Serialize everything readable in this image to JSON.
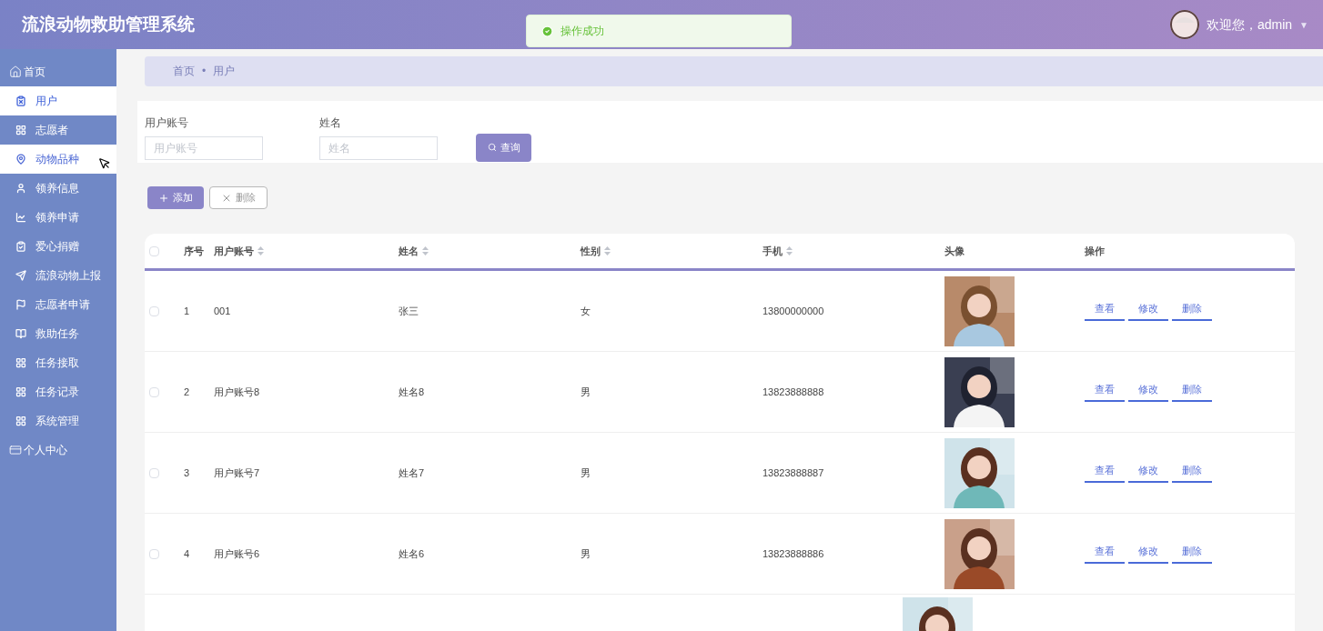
{
  "header": {
    "title": "流浪动物救助管理系统",
    "welcome": "欢迎您，admin",
    "caret": "▼"
  },
  "toast": {
    "message": "操作成功"
  },
  "sidebar": {
    "items": [
      {
        "label": "首页",
        "selected": false,
        "hovered": false,
        "kind": "top"
      },
      {
        "label": "用户",
        "selected": true,
        "hovered": false,
        "kind": "menu"
      },
      {
        "label": "志愿者",
        "selected": false,
        "hovered": false,
        "kind": "menu"
      },
      {
        "label": "动物品种",
        "selected": false,
        "hovered": true,
        "kind": "menu"
      },
      {
        "label": "领养信息",
        "selected": false,
        "hovered": false,
        "kind": "menu"
      },
      {
        "label": "领养申请",
        "selected": false,
        "hovered": false,
        "kind": "menu"
      },
      {
        "label": "爱心捐赠",
        "selected": false,
        "hovered": false,
        "kind": "menu"
      },
      {
        "label": "流浪动物上报",
        "selected": false,
        "hovered": false,
        "kind": "menu"
      },
      {
        "label": "志愿者申请",
        "selected": false,
        "hovered": false,
        "kind": "menu"
      },
      {
        "label": "救助任务",
        "selected": false,
        "hovered": false,
        "kind": "menu"
      },
      {
        "label": "任务接取",
        "selected": false,
        "hovered": false,
        "kind": "menu"
      },
      {
        "label": "任务记录",
        "selected": false,
        "hovered": false,
        "kind": "menu"
      },
      {
        "label": "系统管理",
        "selected": false,
        "hovered": false,
        "kind": "menu"
      },
      {
        "label": "个人中心",
        "selected": false,
        "hovered": false,
        "kind": "top"
      }
    ]
  },
  "breadcrumb": {
    "items": [
      "首页",
      "用户"
    ],
    "separator": "•"
  },
  "search": {
    "fields": [
      {
        "label": "用户账号",
        "placeholder": "用户账号"
      },
      {
        "label": "姓名",
        "placeholder": "姓名"
      }
    ],
    "button": "查询"
  },
  "actions": [
    {
      "label": "添加",
      "kind": "add"
    },
    {
      "label": "删除",
      "kind": "delete"
    }
  ],
  "table": {
    "columns": [
      {
        "label": "序号",
        "sortable": false
      },
      {
        "label": "用户账号",
        "sortable": true
      },
      {
        "label": "姓名",
        "sortable": true
      },
      {
        "label": "性别",
        "sortable": true
      },
      {
        "label": "手机",
        "sortable": true
      },
      {
        "label": "头像",
        "sortable": false
      },
      {
        "label": "操作",
        "sortable": false
      }
    ],
    "select_all": {
      "checked": false
    },
    "rows": [
      {
        "checked": false,
        "cells": [
          "1",
          "001",
          "张三",
          "女",
          "13800000000"
        ],
        "avatar": {
          "kind": "picture"
        },
        "actions": [
          "查看",
          "修改",
          "删除"
        ]
      },
      {
        "checked": false,
        "cells": [
          "2",
          "用户账号8",
          "姓名8",
          "男",
          "13823888888"
        ],
        "avatar": {
          "kind": "picture"
        },
        "actions": [
          "查看",
          "修改",
          "删除"
        ]
      },
      {
        "checked": false,
        "cells": [
          "3",
          "用户账号7",
          "姓名7",
          "男",
          "13823888887"
        ],
        "avatar": {
          "kind": "picture"
        },
        "actions": [
          "查看",
          "修改",
          "删除"
        ]
      },
      {
        "checked": false,
        "cells": [
          "4",
          "用户账号6",
          "姓名6",
          "男",
          "13823888886"
        ],
        "avatar": {
          "kind": "picture"
        },
        "actions": [
          "查看",
          "修改",
          "删除"
        ]
      }
    ]
  }
}
